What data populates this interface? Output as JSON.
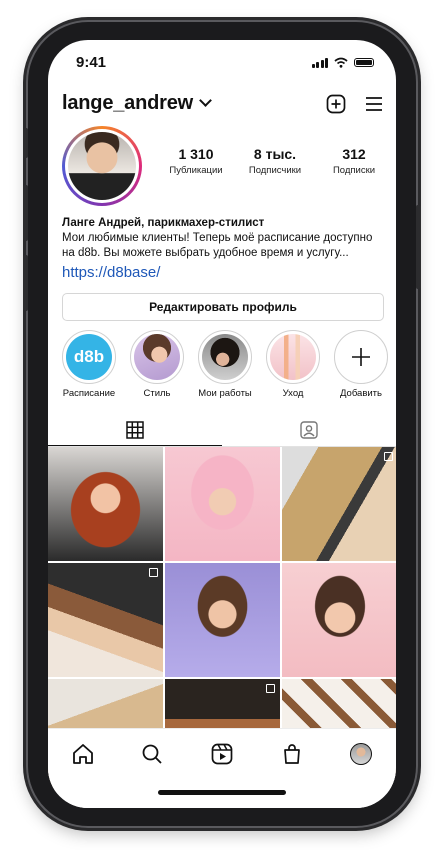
{
  "status": {
    "time": "9:41"
  },
  "profile": {
    "username": "lange_andrew",
    "stats": [
      {
        "value": "1 310",
        "label": "Публикации"
      },
      {
        "value": "8 тыс.",
        "label": "Подписчики"
      },
      {
        "value": "312",
        "label": "Подписки"
      }
    ],
    "bio_name": "Ланге Андрей, парикмахер-стилист",
    "bio_text": "Мои любимые клиенты! Теперь моё расписание доступно на d8b. Вы можете выбрать удобное время и услугу...",
    "link": "https://d8base/",
    "edit_label": "Редактировать профиль"
  },
  "highlights": [
    {
      "label": "Расписание",
      "logo": "d8b"
    },
    {
      "label": "Стиль"
    },
    {
      "label": "Мои работы"
    },
    {
      "label": "Уход"
    },
    {
      "label": "Добавить"
    }
  ],
  "colors": {
    "accent_link": "#1f58b8",
    "logo_bg": "#34b4e6"
  },
  "icons": [
    "add-post-icon",
    "menu-icon",
    "grid-icon",
    "tagged-icon",
    "home-icon",
    "search-icon",
    "reels-icon",
    "shop-icon",
    "profile-avatar-icon"
  ]
}
